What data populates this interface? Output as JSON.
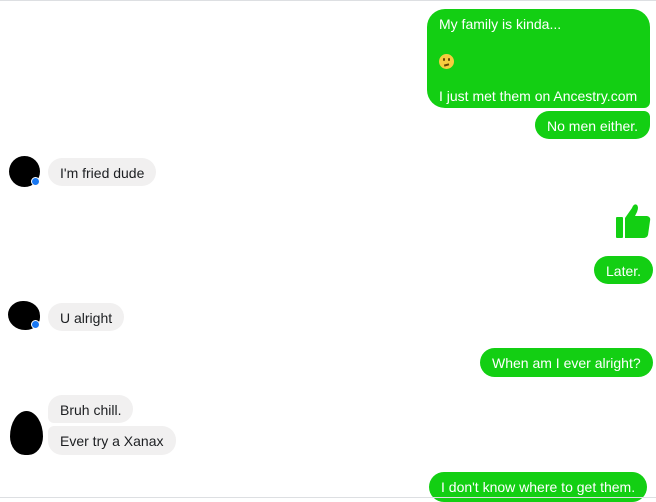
{
  "conversation": {
    "messages": [
      {
        "sender": "me",
        "lines": [
          "My family is kinda...",
          "",
          "I just met them on Ancestry.com"
        ],
        "emoji": "slightly-frowning-face-icon"
      },
      {
        "sender": "me",
        "text": "No men either."
      },
      {
        "sender": "them",
        "text": "I'm fried dude"
      },
      {
        "sender": "me",
        "type": "like",
        "icon": "thumbs-up-icon"
      },
      {
        "sender": "me",
        "text": "Later."
      },
      {
        "sender": "them",
        "text": "U alright"
      },
      {
        "sender": "me",
        "text": "When am I ever alright?"
      },
      {
        "sender": "them",
        "text": "Bruh chill."
      },
      {
        "sender": "them",
        "text": "Ever try a Xanax"
      },
      {
        "sender": "me",
        "text": "I don't know where to get them."
      }
    ]
  },
  "colors": {
    "outgoing_bubble": "#13cf13",
    "incoming_bubble": "#f1f0f0",
    "active_badge": "#1877f2"
  }
}
